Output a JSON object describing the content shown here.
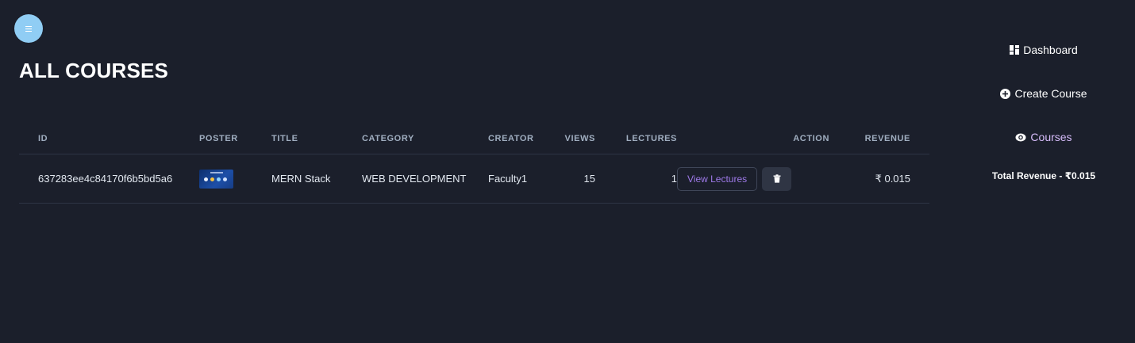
{
  "page": {
    "title": "ALL COURSES"
  },
  "table": {
    "headers": [
      "ID",
      "POSTER",
      "TITLE",
      "CATEGORY",
      "CREATOR",
      "VIEWS",
      "LECTURES",
      "ACTION",
      "REVENUE"
    ],
    "rows": [
      {
        "id": "637283ee4c84170f6b5bd5a6",
        "poster_icon": "course-poster-thumbnail",
        "title": "MERN Stack",
        "category": "WEB DEVELOPMENT",
        "creator": "Faculty1",
        "views": "15",
        "lectures": "1",
        "view_button": "View Lectures",
        "delete_icon": "trash-icon",
        "revenue": "₹ 0.015"
      }
    ]
  },
  "sidebar": {
    "items": [
      {
        "label": "Dashboard",
        "icon": "dashboard-icon"
      },
      {
        "label": "Create Course",
        "icon": "plus-circle-icon"
      },
      {
        "label": "Courses",
        "icon": "eye-icon",
        "active": true
      }
    ],
    "total_revenue": "Total Revenue - ₹0.015"
  },
  "colors": {
    "background": "#1b1f2b",
    "accent": "#9f7aea",
    "active_nav": "#d6bcfa",
    "menu_button": "#90cdf4"
  }
}
